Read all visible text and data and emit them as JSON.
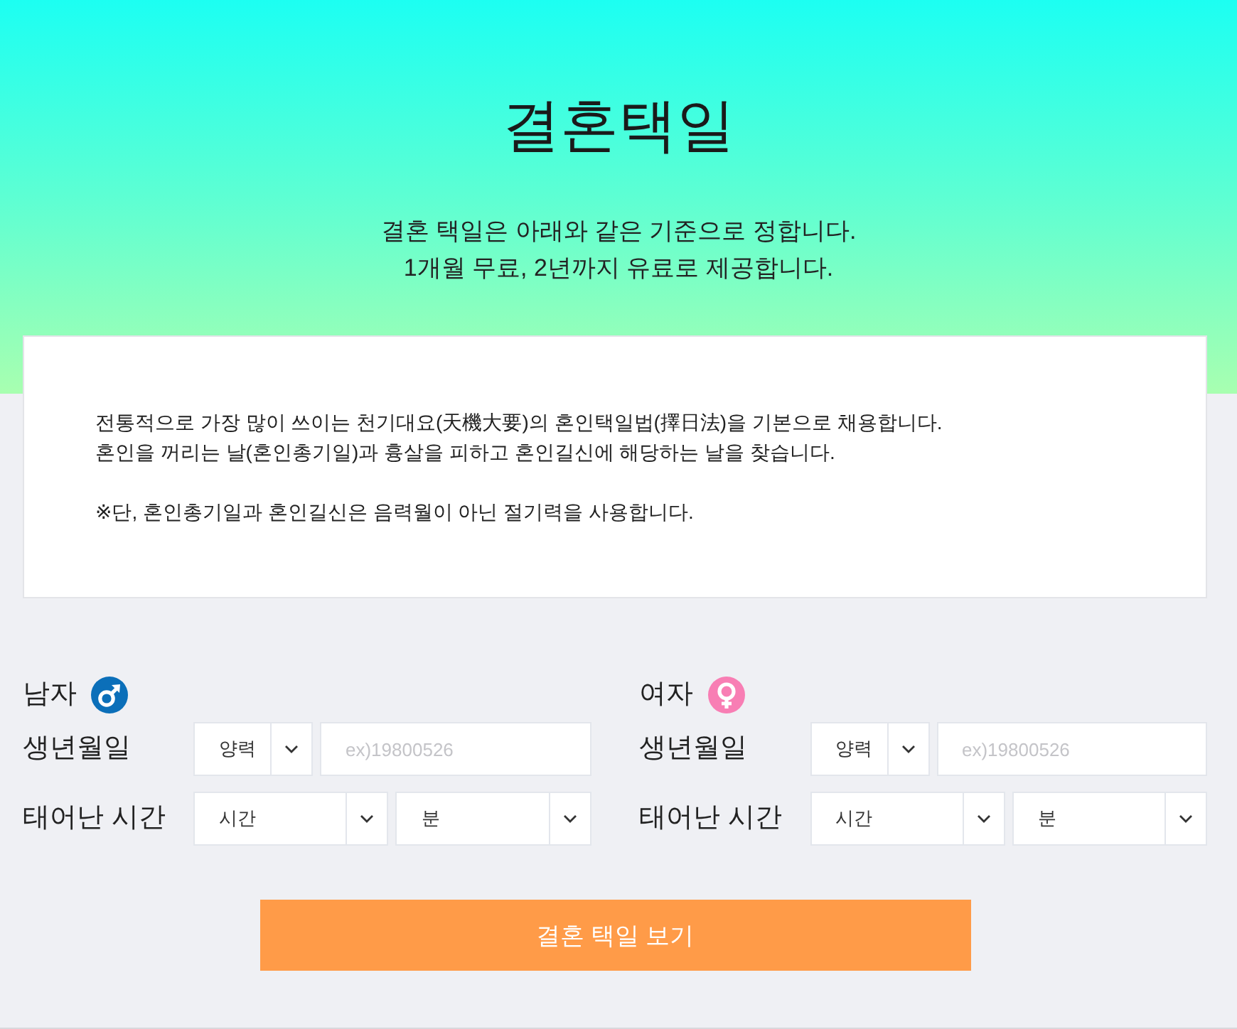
{
  "header": {
    "title": "결혼택일",
    "subtitle_lines": [
      "결혼 택일은 아래와 같은 기준으로 정합니다.",
      "1개월 무료, 2년까지 유료로 제공합니다."
    ]
  },
  "notice": {
    "paragraphs": [
      {
        "lines": [
          "전통적으로 가장 많이 쓰이는 천기대요(天機大要)의 혼인택일법(擇日法)을 기본으로 채용합니다.",
          "혼인을 꺼리는 날(혼인총기일)과 흉살을 피하고 혼인길신에 해당하는 날을 찾습니다."
        ]
      },
      {
        "lines": [
          "※단, 혼인총기일과 혼인길신은 음력월이 아닌 절기력을 사용합니다."
        ]
      }
    ]
  },
  "persons": [
    {
      "label": "남자",
      "kind": "male",
      "birth": {
        "label": "생년월일",
        "calendar": "양력",
        "placeholder": "ex)19800526"
      },
      "time": {
        "label": "태어난 시간",
        "hour": "시간",
        "minute": "분"
      }
    },
    {
      "label": "여자",
      "kind": "female",
      "birth": {
        "label": "생년월일",
        "calendar": "양력",
        "placeholder": "ex)19800526"
      },
      "time": {
        "label": "태어난 시간",
        "hour": "시간",
        "minute": "분"
      }
    }
  ],
  "submit_button": {
    "label": "결혼 택일 보기"
  }
}
